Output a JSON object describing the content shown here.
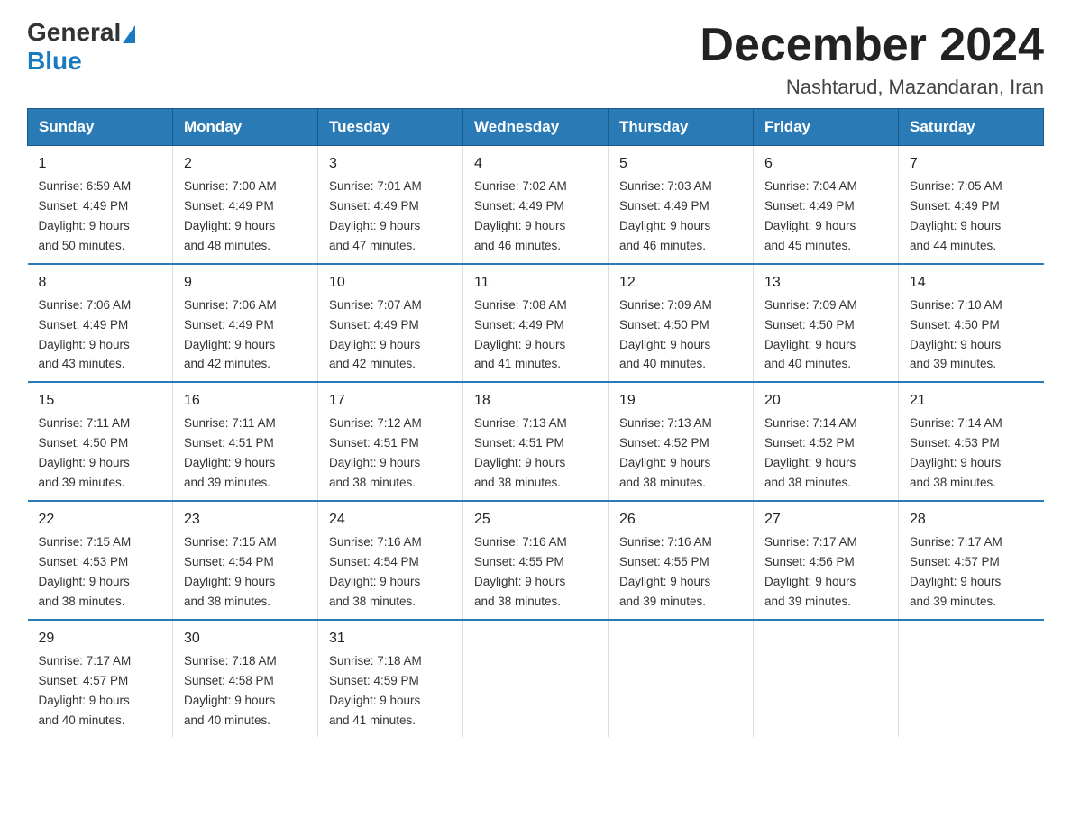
{
  "logo": {
    "general": "General",
    "blue": "Blue"
  },
  "header": {
    "title": "December 2024",
    "subtitle": "Nashtarud, Mazandaran, Iran"
  },
  "weekdays": [
    "Sunday",
    "Monday",
    "Tuesday",
    "Wednesday",
    "Thursday",
    "Friday",
    "Saturday"
  ],
  "weeks": [
    [
      {
        "day": "1",
        "sunrise": "6:59 AM",
        "sunset": "4:49 PM",
        "daylight": "9 hours and 50 minutes."
      },
      {
        "day": "2",
        "sunrise": "7:00 AM",
        "sunset": "4:49 PM",
        "daylight": "9 hours and 48 minutes."
      },
      {
        "day": "3",
        "sunrise": "7:01 AM",
        "sunset": "4:49 PM",
        "daylight": "9 hours and 47 minutes."
      },
      {
        "day": "4",
        "sunrise": "7:02 AM",
        "sunset": "4:49 PM",
        "daylight": "9 hours and 46 minutes."
      },
      {
        "day": "5",
        "sunrise": "7:03 AM",
        "sunset": "4:49 PM",
        "daylight": "9 hours and 46 minutes."
      },
      {
        "day": "6",
        "sunrise": "7:04 AM",
        "sunset": "4:49 PM",
        "daylight": "9 hours and 45 minutes."
      },
      {
        "day": "7",
        "sunrise": "7:05 AM",
        "sunset": "4:49 PM",
        "daylight": "9 hours and 44 minutes."
      }
    ],
    [
      {
        "day": "8",
        "sunrise": "7:06 AM",
        "sunset": "4:49 PM",
        "daylight": "9 hours and 43 minutes."
      },
      {
        "day": "9",
        "sunrise": "7:06 AM",
        "sunset": "4:49 PM",
        "daylight": "9 hours and 42 minutes."
      },
      {
        "day": "10",
        "sunrise": "7:07 AM",
        "sunset": "4:49 PM",
        "daylight": "9 hours and 42 minutes."
      },
      {
        "day": "11",
        "sunrise": "7:08 AM",
        "sunset": "4:49 PM",
        "daylight": "9 hours and 41 minutes."
      },
      {
        "day": "12",
        "sunrise": "7:09 AM",
        "sunset": "4:50 PM",
        "daylight": "9 hours and 40 minutes."
      },
      {
        "day": "13",
        "sunrise": "7:09 AM",
        "sunset": "4:50 PM",
        "daylight": "9 hours and 40 minutes."
      },
      {
        "day": "14",
        "sunrise": "7:10 AM",
        "sunset": "4:50 PM",
        "daylight": "9 hours and 39 minutes."
      }
    ],
    [
      {
        "day": "15",
        "sunrise": "7:11 AM",
        "sunset": "4:50 PM",
        "daylight": "9 hours and 39 minutes."
      },
      {
        "day": "16",
        "sunrise": "7:11 AM",
        "sunset": "4:51 PM",
        "daylight": "9 hours and 39 minutes."
      },
      {
        "day": "17",
        "sunrise": "7:12 AM",
        "sunset": "4:51 PM",
        "daylight": "9 hours and 38 minutes."
      },
      {
        "day": "18",
        "sunrise": "7:13 AM",
        "sunset": "4:51 PM",
        "daylight": "9 hours and 38 minutes."
      },
      {
        "day": "19",
        "sunrise": "7:13 AM",
        "sunset": "4:52 PM",
        "daylight": "9 hours and 38 minutes."
      },
      {
        "day": "20",
        "sunrise": "7:14 AM",
        "sunset": "4:52 PM",
        "daylight": "9 hours and 38 minutes."
      },
      {
        "day": "21",
        "sunrise": "7:14 AM",
        "sunset": "4:53 PM",
        "daylight": "9 hours and 38 minutes."
      }
    ],
    [
      {
        "day": "22",
        "sunrise": "7:15 AM",
        "sunset": "4:53 PM",
        "daylight": "9 hours and 38 minutes."
      },
      {
        "day": "23",
        "sunrise": "7:15 AM",
        "sunset": "4:54 PM",
        "daylight": "9 hours and 38 minutes."
      },
      {
        "day": "24",
        "sunrise": "7:16 AM",
        "sunset": "4:54 PM",
        "daylight": "9 hours and 38 minutes."
      },
      {
        "day": "25",
        "sunrise": "7:16 AM",
        "sunset": "4:55 PM",
        "daylight": "9 hours and 38 minutes."
      },
      {
        "day": "26",
        "sunrise": "7:16 AM",
        "sunset": "4:55 PM",
        "daylight": "9 hours and 39 minutes."
      },
      {
        "day": "27",
        "sunrise": "7:17 AM",
        "sunset": "4:56 PM",
        "daylight": "9 hours and 39 minutes."
      },
      {
        "day": "28",
        "sunrise": "7:17 AM",
        "sunset": "4:57 PM",
        "daylight": "9 hours and 39 minutes."
      }
    ],
    [
      {
        "day": "29",
        "sunrise": "7:17 AM",
        "sunset": "4:57 PM",
        "daylight": "9 hours and 40 minutes."
      },
      {
        "day": "30",
        "sunrise": "7:18 AM",
        "sunset": "4:58 PM",
        "daylight": "9 hours and 40 minutes."
      },
      {
        "day": "31",
        "sunrise": "7:18 AM",
        "sunset": "4:59 PM",
        "daylight": "9 hours and 41 minutes."
      },
      null,
      null,
      null,
      null
    ]
  ],
  "labels": {
    "sunrise": "Sunrise:",
    "sunset": "Sunset:",
    "daylight": "Daylight:"
  }
}
